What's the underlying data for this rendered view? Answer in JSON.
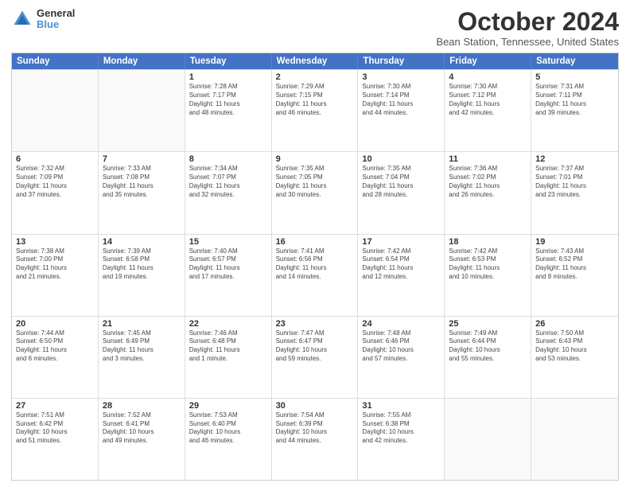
{
  "header": {
    "logo_line1": "General",
    "logo_line2": "Blue",
    "title": "October 2024",
    "location": "Bean Station, Tennessee, United States"
  },
  "calendar": {
    "days_of_week": [
      "Sunday",
      "Monday",
      "Tuesday",
      "Wednesday",
      "Thursday",
      "Friday",
      "Saturday"
    ],
    "rows": [
      [
        {
          "day": "",
          "info": ""
        },
        {
          "day": "",
          "info": ""
        },
        {
          "day": "1",
          "info": "Sunrise: 7:28 AM\nSunset: 7:17 PM\nDaylight: 11 hours\nand 48 minutes."
        },
        {
          "day": "2",
          "info": "Sunrise: 7:29 AM\nSunset: 7:15 PM\nDaylight: 11 hours\nand 46 minutes."
        },
        {
          "day": "3",
          "info": "Sunrise: 7:30 AM\nSunset: 7:14 PM\nDaylight: 11 hours\nand 44 minutes."
        },
        {
          "day": "4",
          "info": "Sunrise: 7:30 AM\nSunset: 7:12 PM\nDaylight: 11 hours\nand 42 minutes."
        },
        {
          "day": "5",
          "info": "Sunrise: 7:31 AM\nSunset: 7:11 PM\nDaylight: 11 hours\nand 39 minutes."
        }
      ],
      [
        {
          "day": "6",
          "info": "Sunrise: 7:32 AM\nSunset: 7:09 PM\nDaylight: 11 hours\nand 37 minutes."
        },
        {
          "day": "7",
          "info": "Sunrise: 7:33 AM\nSunset: 7:08 PM\nDaylight: 11 hours\nand 35 minutes."
        },
        {
          "day": "8",
          "info": "Sunrise: 7:34 AM\nSunset: 7:07 PM\nDaylight: 11 hours\nand 32 minutes."
        },
        {
          "day": "9",
          "info": "Sunrise: 7:35 AM\nSunset: 7:05 PM\nDaylight: 11 hours\nand 30 minutes."
        },
        {
          "day": "10",
          "info": "Sunrise: 7:35 AM\nSunset: 7:04 PM\nDaylight: 11 hours\nand 28 minutes."
        },
        {
          "day": "11",
          "info": "Sunrise: 7:36 AM\nSunset: 7:02 PM\nDaylight: 11 hours\nand 26 minutes."
        },
        {
          "day": "12",
          "info": "Sunrise: 7:37 AM\nSunset: 7:01 PM\nDaylight: 11 hours\nand 23 minutes."
        }
      ],
      [
        {
          "day": "13",
          "info": "Sunrise: 7:38 AM\nSunset: 7:00 PM\nDaylight: 11 hours\nand 21 minutes."
        },
        {
          "day": "14",
          "info": "Sunrise: 7:39 AM\nSunset: 6:58 PM\nDaylight: 11 hours\nand 19 minutes."
        },
        {
          "day": "15",
          "info": "Sunrise: 7:40 AM\nSunset: 6:57 PM\nDaylight: 11 hours\nand 17 minutes."
        },
        {
          "day": "16",
          "info": "Sunrise: 7:41 AM\nSunset: 6:56 PM\nDaylight: 11 hours\nand 14 minutes."
        },
        {
          "day": "17",
          "info": "Sunrise: 7:42 AM\nSunset: 6:54 PM\nDaylight: 11 hours\nand 12 minutes."
        },
        {
          "day": "18",
          "info": "Sunrise: 7:42 AM\nSunset: 6:53 PM\nDaylight: 11 hours\nand 10 minutes."
        },
        {
          "day": "19",
          "info": "Sunrise: 7:43 AM\nSunset: 6:52 PM\nDaylight: 11 hours\nand 8 minutes."
        }
      ],
      [
        {
          "day": "20",
          "info": "Sunrise: 7:44 AM\nSunset: 6:50 PM\nDaylight: 11 hours\nand 6 minutes."
        },
        {
          "day": "21",
          "info": "Sunrise: 7:45 AM\nSunset: 6:49 PM\nDaylight: 11 hours\nand 3 minutes."
        },
        {
          "day": "22",
          "info": "Sunrise: 7:46 AM\nSunset: 6:48 PM\nDaylight: 11 hours\nand 1 minute."
        },
        {
          "day": "23",
          "info": "Sunrise: 7:47 AM\nSunset: 6:47 PM\nDaylight: 10 hours\nand 59 minutes."
        },
        {
          "day": "24",
          "info": "Sunrise: 7:48 AM\nSunset: 6:46 PM\nDaylight: 10 hours\nand 57 minutes."
        },
        {
          "day": "25",
          "info": "Sunrise: 7:49 AM\nSunset: 6:44 PM\nDaylight: 10 hours\nand 55 minutes."
        },
        {
          "day": "26",
          "info": "Sunrise: 7:50 AM\nSunset: 6:43 PM\nDaylight: 10 hours\nand 53 minutes."
        }
      ],
      [
        {
          "day": "27",
          "info": "Sunrise: 7:51 AM\nSunset: 6:42 PM\nDaylight: 10 hours\nand 51 minutes."
        },
        {
          "day": "28",
          "info": "Sunrise: 7:52 AM\nSunset: 6:41 PM\nDaylight: 10 hours\nand 49 minutes."
        },
        {
          "day": "29",
          "info": "Sunrise: 7:53 AM\nSunset: 6:40 PM\nDaylight: 10 hours\nand 46 minutes."
        },
        {
          "day": "30",
          "info": "Sunrise: 7:54 AM\nSunset: 6:39 PM\nDaylight: 10 hours\nand 44 minutes."
        },
        {
          "day": "31",
          "info": "Sunrise: 7:55 AM\nSunset: 6:38 PM\nDaylight: 10 hours\nand 42 minutes."
        },
        {
          "day": "",
          "info": ""
        },
        {
          "day": "",
          "info": ""
        }
      ]
    ]
  }
}
